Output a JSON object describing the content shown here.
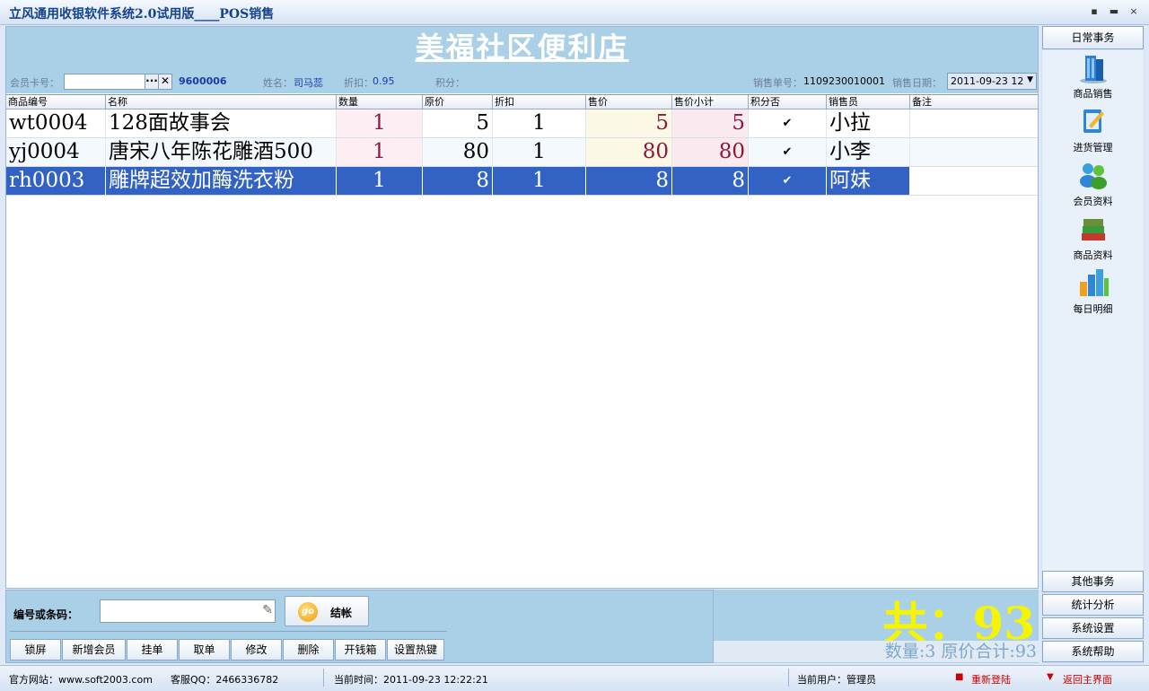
{
  "window": {
    "title": "立风通用收银软件系统2.0试用版____POS销售",
    "minimize_label": "▪",
    "maximize_label": "▬",
    "close_label": "×"
  },
  "store": {
    "name": "美福社区便利店"
  },
  "info": {
    "card_label": "会员卡号：",
    "card_value": "",
    "card_more": "···",
    "card_clear": "✕",
    "member_code": "9600006",
    "name_label": "姓名：",
    "name_value": "司马蕊",
    "discount_label": "折扣：",
    "discount_value": "0.95",
    "points_label": "积分：",
    "points_value": "",
    "order_label": "销售单号：",
    "order_value": "1109230010001",
    "date_label": "销售日期：",
    "date_value": "2011-09-23 12"
  },
  "grid": {
    "columns": [
      "商品编号",
      "名称",
      "数量",
      "原价",
      "折扣",
      "售价",
      "售价小计",
      "积分否",
      "销售员",
      "备注"
    ],
    "rows": [
      {
        "code": "wt0004",
        "name": "128面故事会",
        "qty": "1",
        "price": "5",
        "discount": "1",
        "sale_price": "5",
        "subtotal": "5",
        "points": "✔",
        "seller": "小拉",
        "note": ""
      },
      {
        "code": "yj0004",
        "name": "唐宋八年陈花雕酒500",
        "qty": "1",
        "price": "80",
        "discount": "1",
        "sale_price": "80",
        "subtotal": "80",
        "points": "✔",
        "seller": "小李",
        "note": ""
      },
      {
        "code": "rh0003",
        "name": "雕牌超效加酶洗衣粉",
        "qty": "1",
        "price": "8",
        "discount": "1",
        "sale_price": "8",
        "subtotal": "8",
        "points": "✔",
        "seller": "阿妹",
        "note": ""
      }
    ]
  },
  "input": {
    "code_label": "编号或条码：",
    "code_value": "",
    "checkout_icon": "go",
    "checkout_label": "结帐"
  },
  "buttons": [
    "锁屏",
    "新增会员",
    "挂单",
    "取单",
    "修改",
    "删除",
    "开钱箱",
    "设置热键"
  ],
  "totals": {
    "big": "共：93",
    "summary": "数量:3  原价合计:93"
  },
  "sidebar": {
    "header": "日常事务",
    "items": [
      {
        "label": "商品销售",
        "icon": "building-icon"
      },
      {
        "label": "进货管理",
        "icon": "notepad-icon"
      },
      {
        "label": "会员资料",
        "icon": "users-icon"
      },
      {
        "label": "商品资料",
        "icon": "books-icon"
      },
      {
        "label": "每日明细",
        "icon": "bar-chart-icon"
      }
    ],
    "bottom": [
      "其他事务",
      "统计分析",
      "系统设置",
      "系统帮助"
    ]
  },
  "status": {
    "website": "官方网站：www.soft2003.com",
    "qq": "客服QQ：2466336782",
    "time": "当前时间：2011-09-23 12:22:21",
    "user": "当前用户：管理员",
    "relogin": "重新登陆",
    "back": "返回主界面",
    "relogin_icon": "■",
    "back_icon": "▼"
  },
  "colors": {
    "banner": "#a9d0e6",
    "selected_row": "#3162c4",
    "total_text": "#f5f500"
  }
}
